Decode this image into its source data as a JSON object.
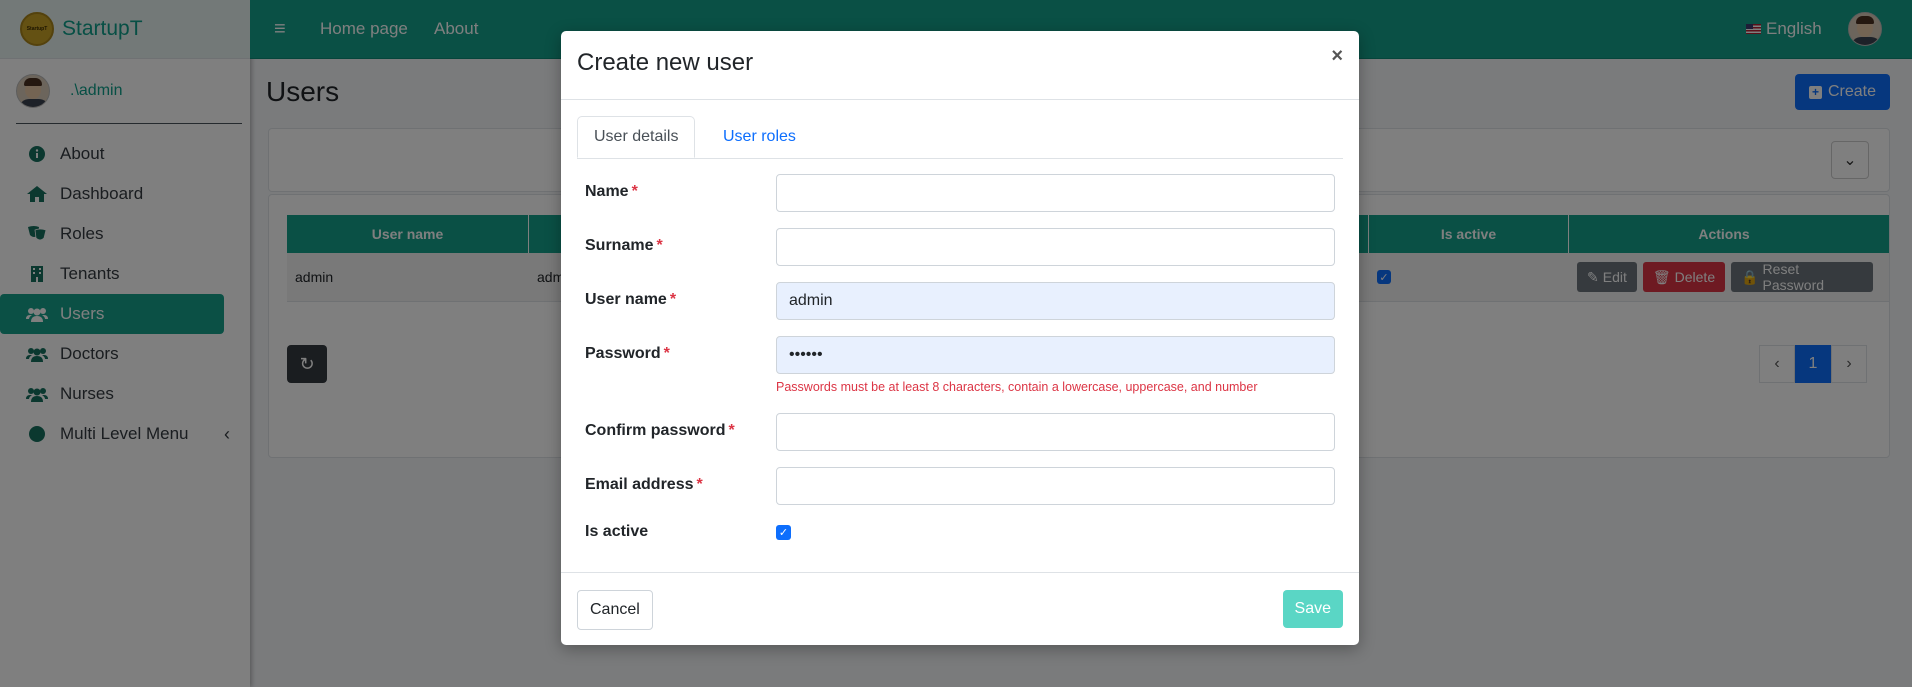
{
  "brand": {
    "name": "StartupT",
    "logo_text": "StartupT"
  },
  "user": {
    "name": ".\\admin"
  },
  "sidebar": {
    "items": [
      {
        "label": "About",
        "icon": "info-icon"
      },
      {
        "label": "Dashboard",
        "icon": "home-icon"
      },
      {
        "label": "Roles",
        "icon": "theater-masks-icon"
      },
      {
        "label": "Tenants",
        "icon": "building-icon"
      },
      {
        "label": "Users",
        "icon": "users-icon",
        "active": true
      },
      {
        "label": "Doctors",
        "icon": "users-icon"
      },
      {
        "label": "Nurses",
        "icon": "users-icon"
      },
      {
        "label": "Multi Level Menu",
        "icon": "circle-icon"
      }
    ]
  },
  "topbar": {
    "menu_icon": "≡",
    "home": "Home page",
    "about": "About",
    "language": "English"
  },
  "page": {
    "title": "Users",
    "create_label": "Create"
  },
  "table": {
    "headers": [
      "User name",
      "Is active",
      "Actions"
    ],
    "rows": [
      {
        "user_name": "admin",
        "name_partial": "adm",
        "is_active": true
      }
    ],
    "actions": {
      "edit": "Edit",
      "delete": "Delete",
      "reset": "Reset Password"
    }
  },
  "pagination": {
    "current": "1"
  },
  "modal": {
    "title": "Create new user",
    "close": "×",
    "tabs": [
      "User details",
      "User roles"
    ],
    "fields": {
      "name": {
        "label": "Name",
        "value": ""
      },
      "surname": {
        "label": "Surname",
        "value": ""
      },
      "username": {
        "label": "User name",
        "value": "admin"
      },
      "password": {
        "label": "Password",
        "value": "••••••",
        "error": "Passwords must be at least 8 characters, contain a lowercase, uppercase, and number"
      },
      "confirm": {
        "label": "Confirm password",
        "value": ""
      },
      "email": {
        "label": "Email address",
        "value": ""
      },
      "active": {
        "label": "Is active",
        "checked": true
      }
    },
    "required_mark": "*",
    "cancel": "Cancel",
    "save": "Save"
  },
  "colors": {
    "brand": "#14a08a",
    "primary": "#0d6efd",
    "danger": "#dc3545"
  }
}
